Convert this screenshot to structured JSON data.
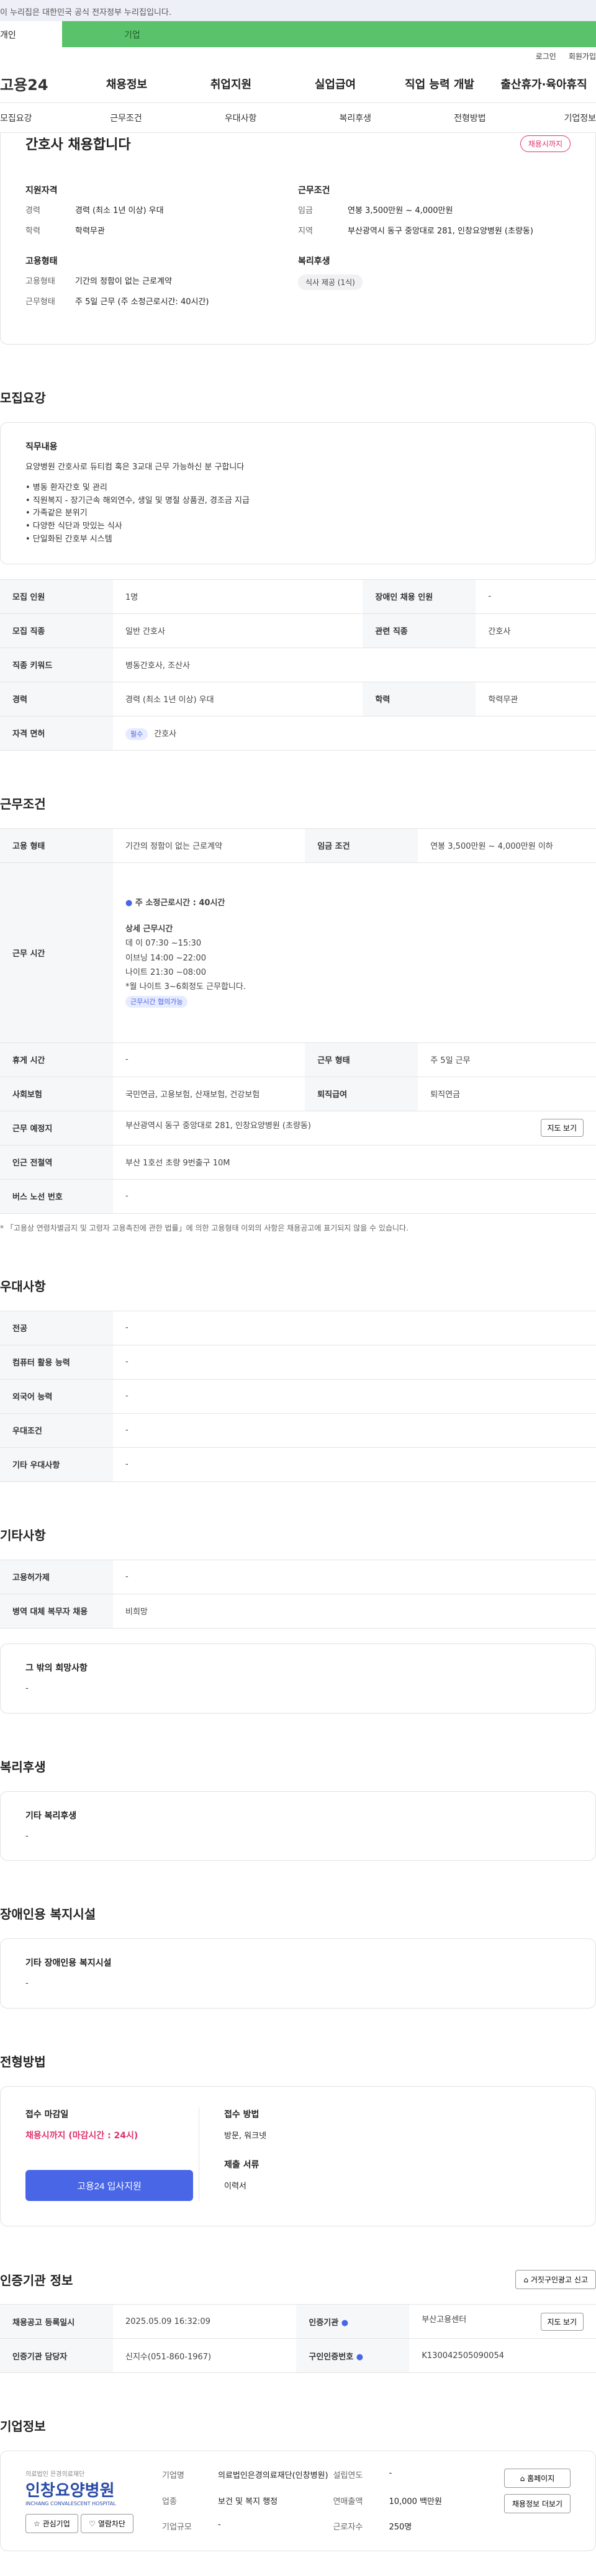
{
  "top_notice": "이 누리집은 대한민국 공식 전자정부 누리집입니다.",
  "user_tabs": {
    "individual": "개인",
    "enterprise": "기업"
  },
  "util": {
    "login": "로그인",
    "join": "회원가입"
  },
  "logo": "고용24",
  "gnb": [
    "채용정보",
    "취업지원",
    "실업급여",
    "직업 능력 개발",
    "출산휴가·육아휴직"
  ],
  "subnav": [
    "모집요강",
    "근무조건",
    "우대사항",
    "복리후생",
    "전형방법",
    "기업정보"
  ],
  "summary": {
    "title": "간호사 채용합니다",
    "status": "채용시까지",
    "qual_head": "지원자격",
    "qual": [
      {
        "k": "경력",
        "v": "경력 (최소 1년 이상) 우대"
      },
      {
        "k": "학력",
        "v": "학력무관"
      }
    ],
    "cond_head": "근무조건",
    "cond": [
      {
        "k": "임금",
        "v": "연봉 3,500만원 ~ 4,000만원"
      },
      {
        "k": "지역",
        "v": "부산광역시 동구 중앙대로 281, 인창요양병원 (초량동)"
      }
    ],
    "emp_head": "고용형태",
    "emp": [
      {
        "k": "고용형태",
        "v": "기간의 정함이 없는 근로계약"
      },
      {
        "k": "근무형태",
        "v": "주 5일 근무 (주 소정근로시간: 40시간)"
      }
    ],
    "welfare_head": "복리후생",
    "welfare_chip": "식사 제공 (1식)"
  },
  "recruit": {
    "title": "모집요강",
    "duty_head": "직무내용",
    "duty_text": "요양병원 간호사로 듀티컴 혹은 3교대 근무 가능하신 분 구합니다",
    "duty_list": [
      "• 병동 환자간호 및 관리",
      "• 직원복지 - 장기근속 해외연수, 생일 및 명절 상품권, 경조금 지급",
      "• 가족같은 분위기",
      "• 다양한 식단과 맛있는 식사",
      "• 단일화된 간호부 시스템"
    ],
    "rows": [
      {
        "k1": "모집 인원",
        "v1": "1명",
        "k2": "장애인 채용 인원",
        "v2": "-"
      },
      {
        "k1": "모집 직종",
        "v1": "일반 간호사",
        "k2": "관련 직종",
        "v2": "간호사"
      },
      {
        "k1": "직종 키워드",
        "v1": "병동간호사, 조산사"
      },
      {
        "k1": "경력",
        "v1": "경력 (최소 1년 이상) 우대",
        "k2": "학력",
        "v2": "학력무관"
      },
      {
        "k1": "자격 면허",
        "tag": "필수",
        "v1": "간호사"
      }
    ]
  },
  "work": {
    "title": "근무조건",
    "emp_type_k": "고용 형태",
    "emp_type_v": "기간의 정함이 없는 근로계약",
    "wage_k": "임금 조건",
    "wage_v": "연봉 3,500만원 ~ 4,000만원 이하",
    "hours_k": "근무 시간",
    "hours_main": "주 소정근로시간 : 40시간",
    "hours_detail_head": "상세 근무시간",
    "hours_detail": [
      "데     이 07:30 ~15:30",
      "이브닝 14:00 ~22:00",
      "나이트 21:30 ~08:00",
      "*월 나이트 3~6회정도 근무합니다."
    ],
    "hours_tag": "근무시간 협의가능",
    "break_k": "휴게 시간",
    "break_v": "-",
    "form_k": "근무 형태",
    "form_v": "주 5일 근무",
    "insurance_k": "사회보험",
    "insurance_v": "국민연금, 고용보험, 산재보험, 건강보험",
    "pension_k": "퇴직급여",
    "pension_v": "퇴직연금",
    "place_k": "근무 예정지",
    "place_v": "부산광역시 동구 중앙대로 281, 인창요양병원 (초량동)",
    "map_btn": "지도 보기",
    "subway_k": "인근 전철역",
    "subway_v": "부산 1호선 초량 9번출구 10M",
    "bus_k": "버스 노선 번호",
    "bus_v": "-",
    "note": "* 「고용상 연령차별금지 및 고령자 고용촉진에 관한 법률」에 의한 고용형태 이외의 사항은 채용공고에 표기되지 않을 수 있습니다."
  },
  "pref": {
    "title": "우대사항",
    "rows": [
      {
        "k": "전공",
        "v": "-"
      },
      {
        "k": "컴퓨터 활용 능력",
        "v": "-"
      },
      {
        "k": "외국어 능력",
        "v": "-"
      },
      {
        "k": "우대조건",
        "v": "-"
      },
      {
        "k": "기타 우대사항",
        "v": "-"
      }
    ]
  },
  "etc": {
    "title": "기타사항",
    "rows": [
      {
        "k": "고용허가제",
        "v": "-"
      },
      {
        "k": "병역 대체 복무자 채용",
        "v": "비희망"
      }
    ],
    "other_head": "그 밖의 희망사항",
    "other_v": "-"
  },
  "benefit": {
    "title": "복리후생",
    "head": "기타 복리후생",
    "v": "-"
  },
  "disabled": {
    "title": "장애인용 복지시설",
    "head": "기타 장애인용 복지시설",
    "v": "-"
  },
  "apply": {
    "title": "전형방법",
    "deadline_head": "접수 마감일",
    "deadline_v": "채용시까지 (마감시간 : 24시)",
    "method_head": "접수 방법",
    "method_v": "방문, 워크넷",
    "docs_head": "제출 서류",
    "docs_v": "이력서",
    "apply_btn": "고용24 입사지원"
  },
  "agency": {
    "title": "인증기관 정보",
    "report_btn": "거짓구인광고 신고",
    "rows": [
      {
        "k1": "채용공고 등록일시",
        "v1": "2025.05.09 16:32:09",
        "k2": "인증기관",
        "v2": "부산고용센터",
        "btn": "지도 보기"
      },
      {
        "k1": "인증기관 담당자",
        "v1": "신지수(051-860-1967)",
        "k2": "구인인증번호",
        "v2": "K130042505090054"
      }
    ]
  },
  "company": {
    "title": "기업정보",
    "logo_sub": "의료법인 은경의료재단",
    "logo_main": "인창요양병원",
    "logo_en": "INCHANG CONVALESCENT HOSPITAL",
    "btn_fav": "관심기업",
    "btn_block": "열람차단",
    "name_k": "기업명",
    "name_v": "의료법인은경의료재단(인창병원)",
    "year_k": "설립연도",
    "year_v": "-",
    "industry_k": "업종",
    "industry_v": "보건 및 복지 행정",
    "sales_k": "연매출액",
    "sales_v": "10,000 백만원",
    "size_k": "기업규모",
    "size_v": "-",
    "staff_k": "근로자수",
    "staff_v": "250명",
    "home_btn": "홈페이지",
    "more_btn": "채용정보 더보기"
  }
}
